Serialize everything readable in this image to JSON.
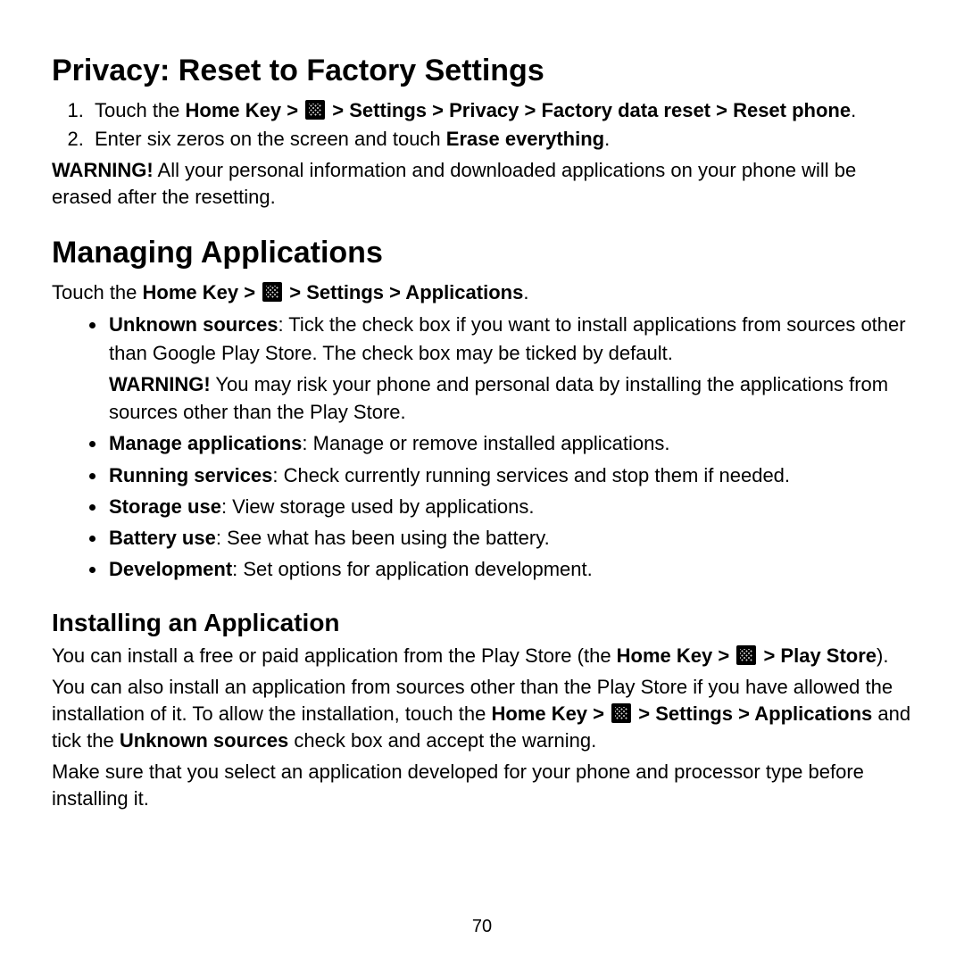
{
  "section1": {
    "heading": "Privacy: Reset to Factory Settings",
    "step1_a": "Touch the ",
    "step1_b": "Home Key > ",
    "step1_c": " > Settings > Privacy > Factory data reset > Reset phone",
    "step1_d": ".",
    "step2_a": "Enter six zeros on the screen and touch ",
    "step2_b": "Erase everything",
    "step2_c": ".",
    "warn_label": "WARNING!",
    "warn_text": " All your personal information and downloaded applications on your phone will be erased after the resetting."
  },
  "section2": {
    "heading": "Managing Applications",
    "intro_a": "Touch the ",
    "intro_b": "Home Key > ",
    "intro_c": " > Settings > Applications",
    "intro_d": ".",
    "bullets": {
      "b1_label": "Unknown sources",
      "b1_text": ": Tick the check box if you want to install applications from sources other than Google Play Store. The check box may be ticked by default.",
      "b1_warn_label": "WARNING!",
      "b1_warn_text": " You may risk your phone and personal data by installing the applications from sources other than the Play Store.",
      "b2_label": "Manage applications",
      "b2_text": ": Manage or remove installed applications.",
      "b3_label": "Running services",
      "b3_text": ": Check currently running services and stop them if needed.",
      "b4_label": "Storage use",
      "b4_text": ": View storage used by applications.",
      "b5_label": "Battery use",
      "b5_text": ": See what has been using the battery.",
      "b6_label": "Development",
      "b6_text": ": Set options for application development."
    }
  },
  "section3": {
    "heading": "Installing an Application",
    "p1_a": "You can install a free or paid application from the Play Store (the ",
    "p1_b": "Home Key > ",
    "p1_c": " > Play Store",
    "p1_d": ").",
    "p2_a": "You can also install an application from sources other than the Play Store if you have allowed the installation of it. To allow the installation, touch the ",
    "p2_b": "Home Key > ",
    "p2_c": " > Settings > Applications",
    "p2_d": " and tick the ",
    "p2_e": "Unknown sources",
    "p2_f": " check box and accept the warning.",
    "p3": "Make sure that you select an application developed for your phone and processor type before installing it."
  },
  "page_number": "70"
}
